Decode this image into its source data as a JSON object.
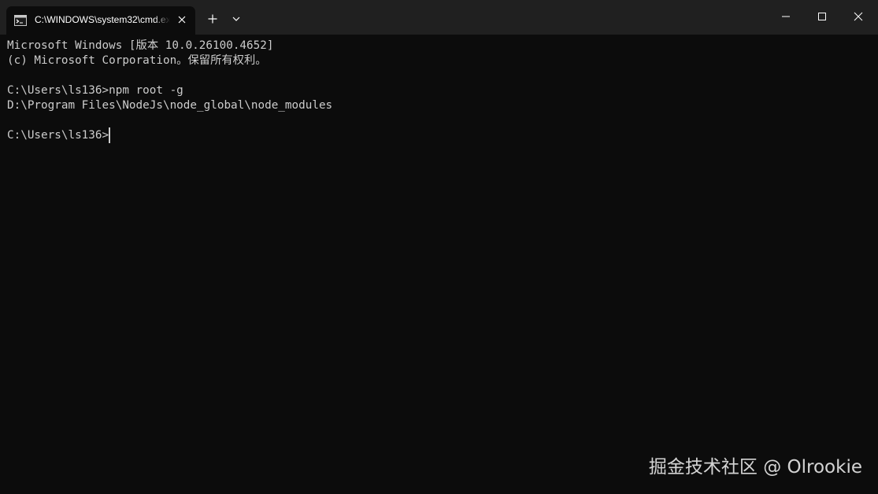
{
  "window": {
    "tab_title": "C:\\WINDOWS\\system32\\cmd.exe",
    "tab_icon": "cmd-icon",
    "new_tab_icon": "plus-icon",
    "dropdown_icon": "chevron-down-icon",
    "controls": [
      "minimize-icon",
      "maximize-icon",
      "close-icon"
    ]
  },
  "terminal": {
    "lines": [
      "Microsoft Windows [版本 10.0.26100.4652]",
      "(c) Microsoft Corporation。保留所有权利。",
      "",
      "C:\\Users\\ls136>npm root -g",
      "D:\\Program Files\\NodeJs\\node_global\\node_modules",
      "",
      "C:\\Users\\ls136>"
    ]
  },
  "watermark": "掘金技术社区 @ Olrookie",
  "colors": {
    "titlebar": "#202020",
    "background": "#0c0c0c",
    "text": "#cccccc"
  }
}
